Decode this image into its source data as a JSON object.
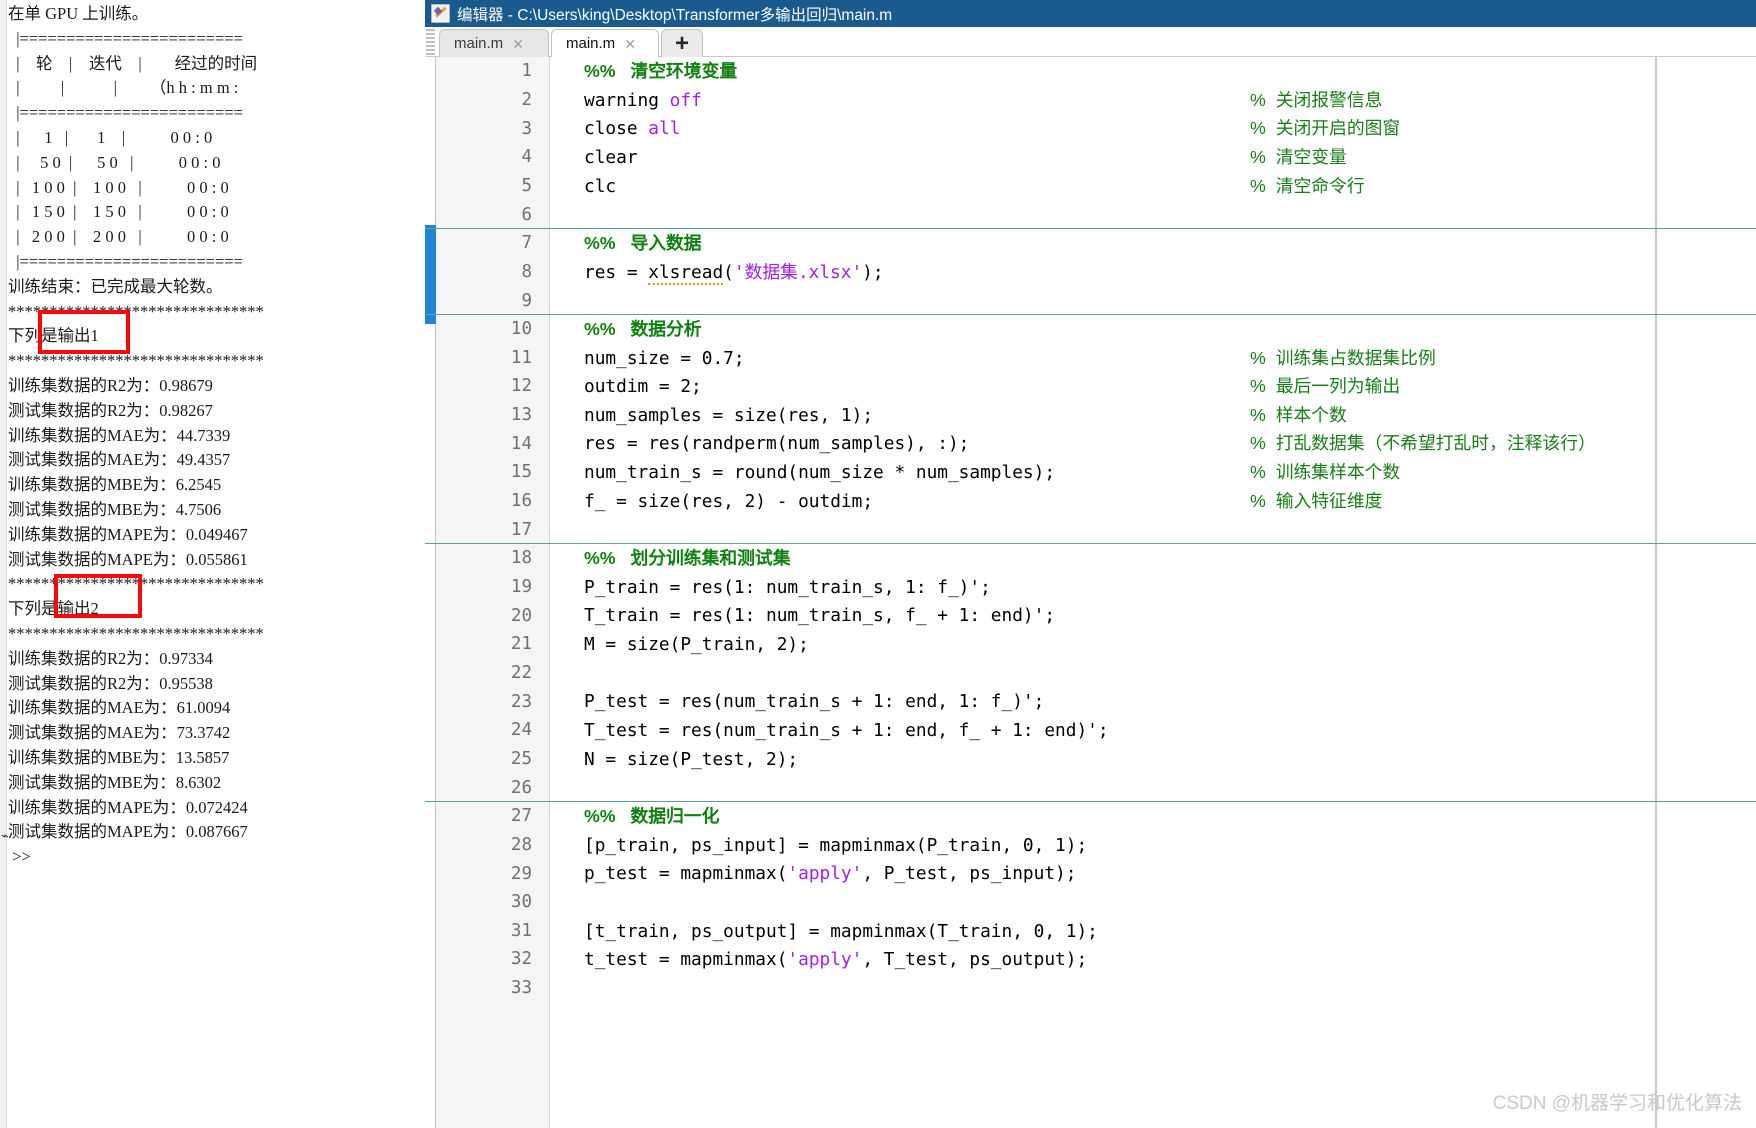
{
  "command_window": {
    "lines": [
      "在单 GPU 上训练。",
      "  |========================",
      "  |    轮    |    迭代    |        经过的时间",
      "  |          |            |        （h h : m m :",
      "  |========================",
      "  |      1   |       1    |           0 0 : 0",
      "  |     5 0  |      5 0   |           0 0 : 0",
      "  |   1 0 0  |    1 0 0   |           0 0 : 0",
      "  |   1 5 0  |    1 5 0   |           0 0 : 0",
      "  |   2 0 0  |    2 0 0   |           0 0 : 0",
      "  |========================",
      "训练结束：已完成最大轮数。",
      "*******************************",
      "下列是输出1",
      "*******************************",
      "训练集数据的R2为：0.98679",
      "测试集数据的R2为：0.98267",
      "训练集数据的MAE为：44.7339",
      "测试集数据的MAE为：49.4357",
      "训练集数据的MBE为：6.2545",
      "测试集数据的MBE为：4.7506",
      "训练集数据的MAPE为：0.049467",
      "测试集数据的MAPE为：0.055861",
      "*******************************",
      "下列是输出2",
      "*******************************",
      "训练集数据的R2为：0.97334",
      "测试集数据的R2为：0.95538",
      "训练集数据的MAE为：61.0094",
      "测试集数据的MAE为：73.3742",
      "训练集数据的MBE为：13.5857",
      "测试集数据的MBE为：8.6302",
      "训练集数据的MAPE为：0.072424",
      "测试集数据的MAPE为：0.087667",
      " >>"
    ],
    "annotation_label_1": "下列是输出1",
    "annotation_label_2": "下列是输出2",
    "annotation_color": "#fb0707"
  },
  "editor": {
    "title": "编辑器 - C:\\Users\\king\\Desktop\\Transformer多输出回归\\main.m",
    "title_icon": "editor-pencil-icon",
    "titlebar_color": "#1b5a8f",
    "tabs": [
      {
        "label": "main.m",
        "close": "✕",
        "active": false
      },
      {
        "label": "main.m",
        "close": "✕",
        "active": true
      }
    ],
    "new_tab_label": "+",
    "code_lines": [
      {
        "n": "1",
        "text": "",
        "sec": "%%   清空环境变量",
        "cmt": ""
      },
      {
        "n": "2",
        "text": "warning ",
        "kw": "off",
        "cmt": "%  关闭报警信息"
      },
      {
        "n": "3",
        "text": "close ",
        "kw": "all",
        "cmt": "%  关闭开启的图窗"
      },
      {
        "n": "4",
        "text": "clear",
        "kw": "",
        "cmt": "%  清空变量"
      },
      {
        "n": "5",
        "text": "clc",
        "kw": "",
        "cmt": "%  清空命令行"
      },
      {
        "n": "6",
        "text": "",
        "kw": "",
        "cmt": ""
      },
      {
        "n": "7",
        "text": "",
        "sec": "%%   导入数据",
        "cmt": ""
      },
      {
        "n": "8",
        "text": "res = xlsread('数据集.xlsx');",
        "kw": "",
        "cmt": ""
      },
      {
        "n": "9",
        "text": "",
        "kw": "",
        "cmt": ""
      },
      {
        "n": "10",
        "text": "",
        "sec": "%%   数据分析",
        "cmt": ""
      },
      {
        "n": "11",
        "text": "num_size = 0.7;",
        "kw": "",
        "cmt": "%  训练集占数据集比例"
      },
      {
        "n": "12",
        "text": "outdim = 2;",
        "kw": "",
        "cmt": "%  最后一列为输出"
      },
      {
        "n": "13",
        "text": "num_samples = size(res, 1);",
        "kw": "",
        "cmt": "%  样本个数"
      },
      {
        "n": "14",
        "text": "res = res(randperm(num_samples), :);",
        "kw": "",
        "cmt": "%  打乱数据集（不希望打乱时，注释该行）"
      },
      {
        "n": "15",
        "text": "num_train_s = round(num_size * num_samples);",
        "kw": "",
        "cmt": "%  训练集样本个数"
      },
      {
        "n": "16",
        "text": "f_ = size(res, 2) - outdim;",
        "kw": "",
        "cmt": "%  输入特征维度"
      },
      {
        "n": "17",
        "text": "",
        "kw": "",
        "cmt": ""
      },
      {
        "n": "18",
        "text": "",
        "sec": "%%   划分训练集和测试集",
        "cmt": ""
      },
      {
        "n": "19",
        "text": "P_train = res(1: num_train_s, 1: f_)';",
        "kw": "",
        "cmt": ""
      },
      {
        "n": "20",
        "text": "T_train = res(1: num_train_s, f_ + 1: end)';",
        "kw": "",
        "cmt": ""
      },
      {
        "n": "21",
        "text": "M = size(P_train, 2);",
        "kw": "",
        "cmt": ""
      },
      {
        "n": "22",
        "text": "",
        "kw": "",
        "cmt": ""
      },
      {
        "n": "23",
        "text": "P_test = res(num_train_s + 1: end, 1: f_)';",
        "kw": "",
        "cmt": ""
      },
      {
        "n": "24",
        "text": "T_test = res(num_train_s + 1: end, f_ + 1: end)';",
        "kw": "",
        "cmt": ""
      },
      {
        "n": "25",
        "text": "N = size(P_test, 2);",
        "kw": "",
        "cmt": ""
      },
      {
        "n": "26",
        "text": "",
        "kw": "",
        "cmt": ""
      },
      {
        "n": "27",
        "text": "",
        "sec": "%%   数据归一化",
        "cmt": ""
      },
      {
        "n": "28",
        "text": "[p_train, ps_input] = mapminmax(P_train, 0, 1);",
        "kw": "",
        "cmt": ""
      },
      {
        "n": "29",
        "text": "p_test = mapminmax('apply', P_test, ps_input);",
        "kw": "",
        "cmt": ""
      },
      {
        "n": "30",
        "text": "",
        "kw": "",
        "cmt": ""
      },
      {
        "n": "31",
        "text": "[t_train, ps_output] = mapminmax(T_train, 0, 1);",
        "kw": "",
        "cmt": ""
      },
      {
        "n": "32",
        "text": "t_test = mapminmax('apply', T_test, ps_output);",
        "kw": "",
        "cmt": ""
      },
      {
        "n": "33",
        "text": "",
        "kw": "",
        "cmt": ""
      }
    ]
  },
  "watermark": "CSDN @机器学习和优化算法"
}
